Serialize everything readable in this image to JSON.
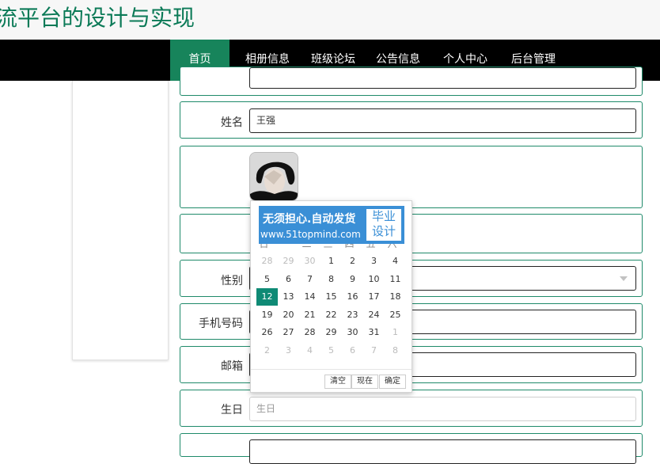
{
  "site": {
    "title": "流平台的设计与实现"
  },
  "nav": {
    "items": [
      "首页",
      "相册信息",
      "班级论坛",
      "公告信息",
      "个人中心",
      "后台管理"
    ]
  },
  "form": {
    "name_label": "姓名",
    "name_value": "王强",
    "gender_label": "性别",
    "phone_label": "手机号码",
    "email_label": "邮箱",
    "birthday_label": "生日",
    "birthday_placeholder": "生日"
  },
  "datepicker": {
    "ad_line1": "无须担心.自动发货",
    "ad_line2": "www.51topmind.com",
    "ad_right_l1": "毕业",
    "ad_right_l2": "设计",
    "weekdays": [
      "日",
      "一",
      "二",
      "三",
      "四",
      "五",
      "六"
    ],
    "days": [
      [
        "28",
        "29",
        "30",
        "1",
        "2",
        "3",
        "4"
      ],
      [
        "5",
        "6",
        "7",
        "8",
        "9",
        "10",
        "11"
      ],
      [
        "12",
        "13",
        "14",
        "15",
        "16",
        "17",
        "18"
      ],
      [
        "19",
        "20",
        "21",
        "22",
        "23",
        "24",
        "25"
      ],
      [
        "26",
        "27",
        "28",
        "29",
        "30",
        "31",
        "1"
      ],
      [
        "2",
        "3",
        "4",
        "5",
        "6",
        "7",
        "8"
      ]
    ],
    "selected_day": "12",
    "clear_label": "清空",
    "now_label": "现在",
    "confirm_label": "确定"
  },
  "colors": {
    "brand_green": "#17845b",
    "row_border": "#1f8a6a",
    "selected_day": "#0f8a75"
  }
}
